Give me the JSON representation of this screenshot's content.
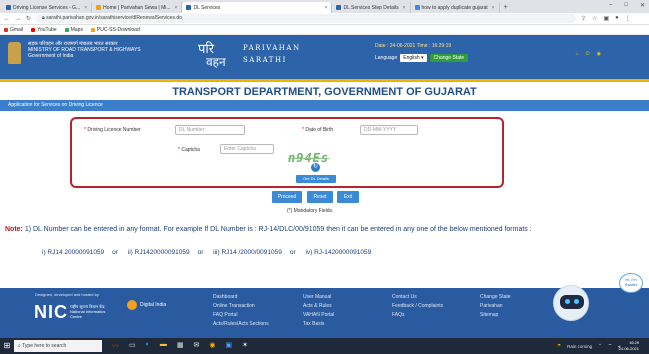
{
  "browser": {
    "tabs": [
      {
        "label": "Driving License Services - G...",
        "active": false,
        "favicon_color": "#2d63a9"
      },
      {
        "label": "Home | Parivahan Sewa | Mi...",
        "active": false,
        "favicon_color": "#f0a020"
      },
      {
        "label": "DL Services",
        "active": true,
        "favicon_color": "#2d63a9"
      },
      {
        "label": "DL Services Step Details",
        "active": false,
        "favicon_color": "#2d63a9"
      },
      {
        "label": "how to apply duplicate gujarat",
        "active": false,
        "favicon_color": "#4285f4"
      }
    ],
    "url": "sarathi.parivahan.gov.in/sarathiservice/dlRenewalServices.do",
    "bookmarks": [
      {
        "label": "Gmail",
        "color": "#d93025"
      },
      {
        "label": "YouTube",
        "color": "#ff0000"
      },
      {
        "label": "Maps",
        "color": "#34a853"
      },
      {
        "label": "PUC-SS-Download",
        "color": "#f2a024"
      }
    ]
  },
  "header": {
    "ministry_hindi": "सड़क परिवहन और राजमार्ग मंत्रालय भारत सरकार",
    "ministry_en": "MINISTRY OF ROAD TRANSPORT & HIGHWAYS",
    "government": "Government of India",
    "parivahan": "PARIVAHAN",
    "sarathi": "SARATHI",
    "date_text": "Date : 24-06-2021  Time : 16:29:19",
    "language_label": "Language",
    "language_value": "English",
    "change_state": "Change State"
  },
  "title": "TRANSPORT DEPARTMENT, GOVERNMENT OF GUJARAT",
  "section_title": "Application for Services on Driving Licence",
  "form": {
    "dl_label": "Driving Licence Number",
    "dl_placeholder": "DL Number",
    "dob_label": "Date of Birth",
    "dob_placeholder": "DD-MM-YYYY",
    "captcha_label": "Captcha",
    "captcha_placeholder": "Enter Captcha",
    "captcha_text": "n94Es",
    "verify": "Get DL Details",
    "proceed": "Proceed",
    "reset": "Reset",
    "exit": "Exit",
    "mandatory": "(*) Mandatory Fields."
  },
  "note": {
    "prefix": "Note:",
    "text": " 1) DL Number can be entered in any format. For example If DL Number is : RJ-14/DLC/00/91059 then it can be entered in any one of the below mentioned formats :",
    "formats": [
      "i) RJ14 20000091059",
      "ii) RJ1420000091059",
      "iii) RJ14 /2000/0091059",
      "iv) RJ-1420000091059"
    ],
    "or": "or"
  },
  "chat": {
    "bubble": "Hi, I'm Saarthi"
  },
  "footer": {
    "designed_by": "Designed, developed and hosted by",
    "nic": "NIC",
    "nic_sub": "राष्ट्रीय सूचना विज्ञान केंद्र National Informatics Centre",
    "digital_india": "Digital India",
    "col1": [
      "Dashboard",
      "Online Transaction",
      "FAQ Portal",
      "Acts/Rules/Acts Sections"
    ],
    "col2": [
      "User Manual",
      "Acts & Rules",
      "VAHAN Portal",
      "Tax Basis"
    ],
    "col3": [
      "Contact Us",
      "Feedback / Complaints",
      "FAQs"
    ],
    "col4": [
      "Change State",
      "Parivahan",
      "Sitemap"
    ]
  },
  "taskbar": {
    "search_placeholder": "Type here to search",
    "weather": "Rain coming",
    "clock_time": "16:29",
    "clock_date": "24-06-2021"
  }
}
